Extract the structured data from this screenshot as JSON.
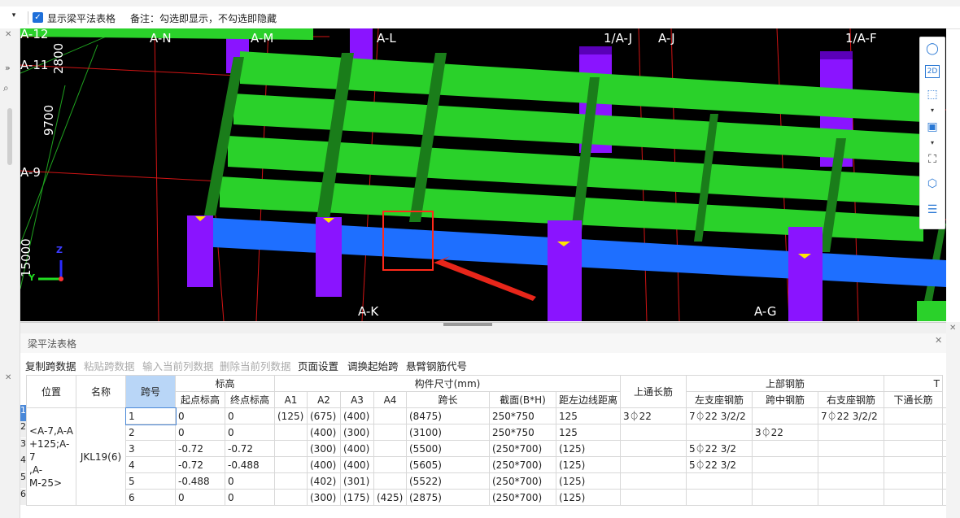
{
  "toolbar": {
    "show_table_label": "显示梁平法表格",
    "note": "备注：勾选即显示，不勾选即隐藏",
    "checked": true
  },
  "viewport": {
    "axis_labels": {
      "a12": "A-12",
      "a11": "A-11",
      "a9": "A-9",
      "an": "A-N",
      "am": "A-M",
      "al": "A-L",
      "a1j": "1/A-J",
      "aj": "A-J",
      "a1f": "1/A-F",
      "ak": "A-K",
      "ag": "A-G"
    },
    "dimensions": {
      "d2800": "2800",
      "d9700": "9700",
      "d15000": "15000"
    },
    "axis_z": "Z",
    "axis_y": "Y"
  },
  "panel": {
    "title": "梁平法表格",
    "tools": [
      {
        "label": "复制跨数据",
        "enabled": true
      },
      {
        "label": "粘贴跨数据",
        "enabled": false
      },
      {
        "label": "输入当前列数据",
        "enabled": false
      },
      {
        "label": "删除当前列数据",
        "enabled": false
      },
      {
        "label": "页面设置",
        "enabled": true
      },
      {
        "label": "调换起始跨",
        "enabled": true
      },
      {
        "label": "悬臂钢筋代号",
        "enabled": true
      }
    ]
  },
  "table": {
    "headers": {
      "position": "位置",
      "name": "名称",
      "span": "跨号",
      "elevation": "标高",
      "start_elev": "起点标高",
      "end_elev": "终点标高",
      "size": "构件尺寸(mm)",
      "a1": "A1",
      "a2": "A2",
      "a3": "A3",
      "a4": "A4",
      "span_len": "跨长",
      "section": "截面(B*H)",
      "edge_dist": "距左边线距离",
      "top_through": "上通长筋",
      "top_rebar": "上部钢筋",
      "left_seat": "左支座钢筋",
      "mid_span": "跨中钢筋",
      "right_seat": "右支座钢筋",
      "bottom_through": "下通长筋",
      "extra": "T"
    },
    "position_value": "<A-7,A-A+125;A-7,A-M-25>",
    "position_lines": [
      "<A-7,A-A",
      "+125;A-7",
      ",A-",
      "M-25>"
    ],
    "name_value": "JKL19(6)",
    "row_numbers": [
      "1",
      "2",
      "3",
      "4",
      "5",
      "6"
    ],
    "rows": [
      {
        "span": "1",
        "start": "0",
        "end": "0",
        "a1": "(125)",
        "a2": "(675)",
        "a3": "(400)",
        "a4": "",
        "len": "(8475)",
        "sec": "250*750",
        "dist": "125",
        "top": "3⏀22",
        "left": "7⏀22 3/2/2",
        "mid": "",
        "right": "7⏀22 3/2/2",
        "bot": ""
      },
      {
        "span": "2",
        "start": "0",
        "end": "0",
        "a1": "",
        "a2": "(400)",
        "a3": "(300)",
        "a4": "",
        "len": "(3100)",
        "sec": "250*750",
        "dist": "125",
        "top": "",
        "left": "",
        "mid": "3⏀22",
        "right": "",
        "bot": ""
      },
      {
        "span": "3",
        "start": "-0.72",
        "end": "-0.72",
        "a1": "",
        "a2": "(300)",
        "a3": "(400)",
        "a4": "",
        "len": "(5500)",
        "sec": "(250*700)",
        "dist": "(125)",
        "top": "",
        "left": "5⏀22 3/2",
        "mid": "",
        "right": "",
        "bot": ""
      },
      {
        "span": "4",
        "start": "-0.72",
        "end": "-0.488",
        "a1": "",
        "a2": "(400)",
        "a3": "(400)",
        "a4": "",
        "len": "(5605)",
        "sec": "(250*700)",
        "dist": "(125)",
        "top": "",
        "left": "5⏀22 3/2",
        "mid": "",
        "right": "",
        "bot": ""
      },
      {
        "span": "5",
        "start": "-0.488",
        "end": "0",
        "a1": "",
        "a2": "(402)",
        "a3": "(301)",
        "a4": "",
        "len": "(5522)",
        "sec": "(250*700)",
        "dist": "(125)",
        "top": "",
        "left": "",
        "mid": "",
        "right": "",
        "bot": ""
      },
      {
        "span": "6",
        "start": "0",
        "end": "0",
        "a1": "",
        "a2": "(300)",
        "a3": "(175)",
        "a4": "(425)",
        "len": "(2875)",
        "sec": "(250*700)",
        "dist": "(125)",
        "top": "",
        "left": "",
        "mid": "",
        "right": "",
        "bot": ""
      }
    ]
  },
  "colors": {
    "beam_green": "#2ad12a",
    "beam_blue": "#1e6fff",
    "column_purple": "#8a14ff",
    "grid_red": "#d21414",
    "highlight_box": "#ff2a1a",
    "header_selected": "#b9d6f7"
  }
}
